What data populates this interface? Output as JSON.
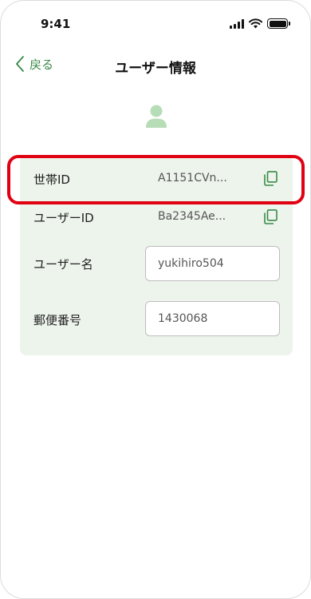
{
  "status_bar": {
    "time": "9:41",
    "signal_icon": "signal-bars-icon",
    "wifi_icon": "wifi-icon",
    "battery_icon": "battery-icon"
  },
  "nav": {
    "back_label": "戻る",
    "back_icon": "chevron-left-icon",
    "title": "ユーザー情報"
  },
  "avatar": {
    "icon": "person-icon",
    "color": "#b7ddb7"
  },
  "fields": {
    "household_id": {
      "label": "世帯ID",
      "value": "A1151CVn...",
      "copy_icon": "copy-icon"
    },
    "user_id": {
      "label": "ユーザーID",
      "value": "Ba2345Ae...",
      "copy_icon": "copy-icon"
    },
    "user_name": {
      "label": "ユーザー名",
      "value": "yukihiro504"
    },
    "postal_code": {
      "label": "郵便番号",
      "value": "1430068"
    }
  },
  "colors": {
    "accent": "#3a8a48",
    "card_bg": "#edf4ec",
    "highlight": "#e00012"
  }
}
